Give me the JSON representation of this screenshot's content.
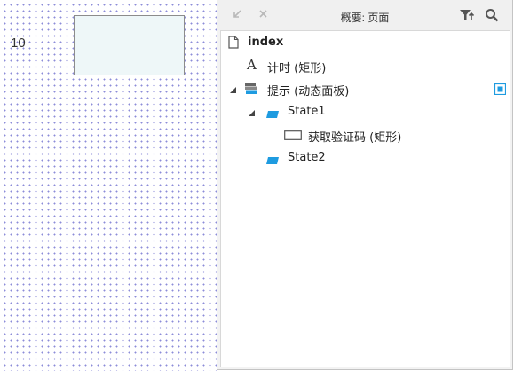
{
  "canvas": {
    "number_text": "10"
  },
  "panel": {
    "title": "概要: 页面",
    "icons": {
      "back": "arrow-down-left-icon",
      "close": "close-icon",
      "filter": "filter-icon",
      "search": "search-icon"
    }
  },
  "tree": {
    "root": {
      "label": "index",
      "icon": "page-icon"
    },
    "items": [
      {
        "label": "计时 (矩形)",
        "icon": "text-icon"
      },
      {
        "label": "提示 (动态面板)",
        "icon": "dynamic-panel-icon",
        "expanded": true
      },
      {
        "label": "State1",
        "icon": "state-icon",
        "expanded": true
      },
      {
        "label": "获取验证码 (矩形)",
        "icon": "rectangle-icon"
      },
      {
        "label": "State2",
        "icon": "state-icon"
      }
    ]
  },
  "colors": {
    "state_icon": "#1e9be0",
    "panel_bg": "#f3f3f3",
    "grid_dots": "#8c8cd8",
    "canvas_rect_fill": "#eef7f8"
  }
}
